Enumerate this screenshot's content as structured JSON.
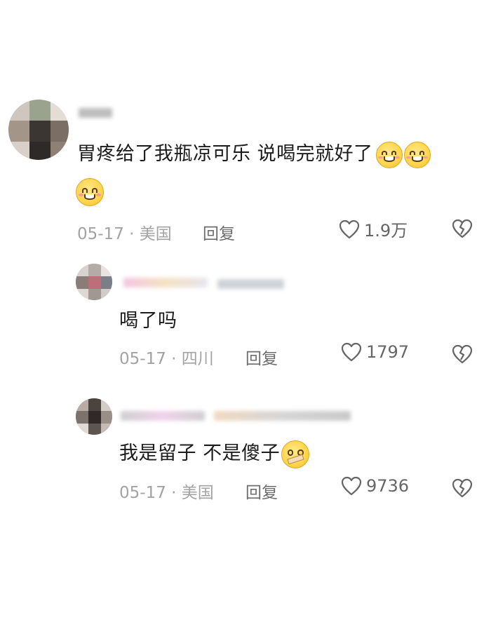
{
  "comments": [
    {
      "text": "胃疼给了我瓶凉可乐 说喝完就好了",
      "date": "05-17",
      "location": "美国",
      "reply_label": "回复",
      "likes": "1.9万",
      "emoji": "smile-emoji"
    },
    {
      "text": "喝了吗",
      "date": "05-17",
      "location": "四川",
      "reply_label": "回复",
      "likes": "1797"
    },
    {
      "text": "我是留子 不是傻子",
      "date": "05-17",
      "location": "美国",
      "reply_label": "回复",
      "likes": "9736",
      "emoji": "shush-emoji"
    }
  ],
  "separator": "·",
  "colors": {
    "meta": "#a3a3a3",
    "text": "#1c1c1c",
    "icon": "#666666"
  }
}
